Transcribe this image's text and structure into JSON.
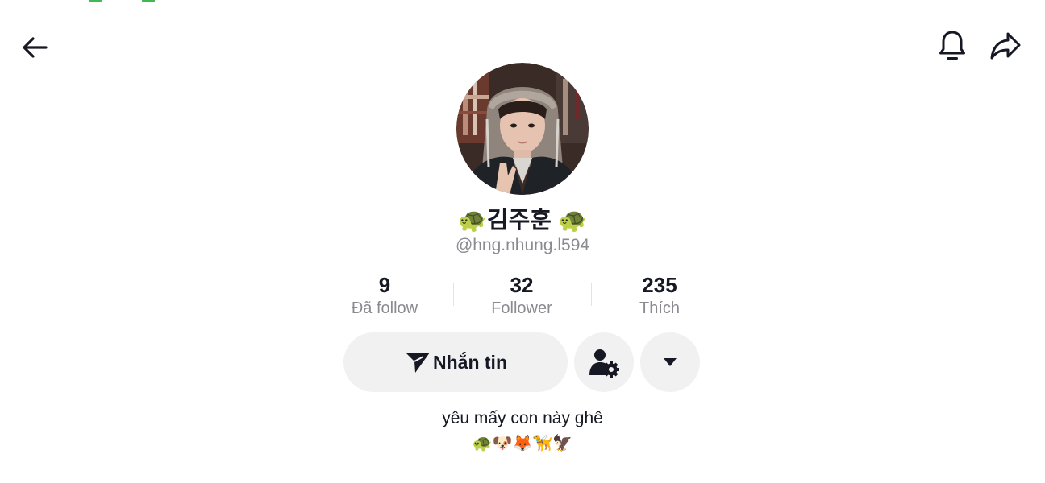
{
  "header": {
    "back_icon": "arrow-left-icon",
    "notification_icon": "bell-icon",
    "share_icon": "share-arrow-icon"
  },
  "profile": {
    "avatar_alt": "avatar",
    "display_name": "🐢김주훈 🐢",
    "username": "@hng.nhung.l594"
  },
  "stats": [
    {
      "value": "9",
      "label": "Đã follow"
    },
    {
      "value": "32",
      "label": "Follower"
    },
    {
      "value": "235",
      "label": "Thích"
    }
  ],
  "actions": {
    "message_label": "Nhắn tin",
    "message_icon": "send-plane-icon",
    "profile_settings_icon": "person-gear-icon",
    "more_icon": "caret-down-icon"
  },
  "bio": {
    "text": "yêu mấy con này ghê",
    "emojis": "🐢🐶🦊🦮🦅"
  },
  "colors": {
    "text_primary": "#161823",
    "text_secondary": "#8a8b91",
    "button_bg": "#f1f1f2",
    "top_strip": "#3fb950"
  }
}
